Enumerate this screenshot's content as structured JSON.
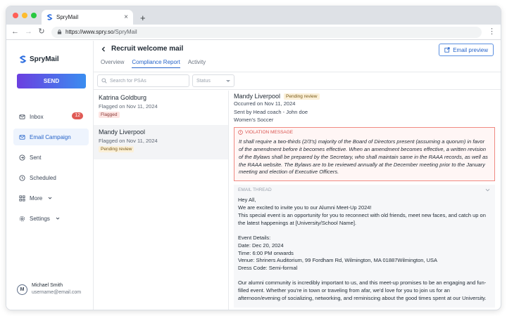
{
  "browser": {
    "tab_title": "SpryMail",
    "url_host": "https://www.spry.so",
    "url_path": "/SpryMail"
  },
  "sidebar": {
    "brand": "SpryMail",
    "send_label": "SEND",
    "items": [
      {
        "label": "Inbox",
        "icon": "inbox-icon",
        "badge": "12"
      },
      {
        "label": "Email Campaign",
        "icon": "mail-icon",
        "active": true
      },
      {
        "label": "Sent",
        "icon": "sent-icon"
      },
      {
        "label": "Scheduled",
        "icon": "clock-icon"
      },
      {
        "label": "More",
        "icon": "grid-icon"
      },
      {
        "label": "Settings",
        "icon": "gear-icon"
      }
    ],
    "user": {
      "initial": "M",
      "name": "Michael Smith",
      "email": "username@email.com"
    }
  },
  "header": {
    "title": "Recruit welcome mail",
    "preview_label": "Email preview",
    "tabs": [
      {
        "label": "Overview"
      },
      {
        "label": "Compliance Report",
        "active": true
      },
      {
        "label": "Activity"
      }
    ]
  },
  "filters": {
    "search_placeholder": "Search for PSAs",
    "status_placeholder": "Status"
  },
  "list": [
    {
      "name": "Katrina Goldburg",
      "date": "Flagged on Nov 11, 2024",
      "tag": "Flagged"
    },
    {
      "name": "Mandy Liverpool",
      "date": "Flagged on Nov 11, 2024",
      "tag": "Pending review"
    }
  ],
  "detail": {
    "name": "Mandy Liverpool",
    "status": "Pending review",
    "occurred": "Occurred on Nov 11, 2024",
    "sent_by": "Sent by Head coach - John doe",
    "team": "Women's Soccer",
    "violation_label": "VIOLATION MESSAGE",
    "violation_text": "It shall require a two-thirds (2/3's) majority of the Board of Directors present (assuming a quorum) in favor of the amendment before it becomes effective.  When an amendment becomes effective, a written revision of the Bylaws shall be prepared by the Secretary, who shall maintain same in the RAAA records, as well as the RAAA website.  The Bylaws are to be reviewed annually at the December meeting prior to the January meeting and election of Executive Officers.",
    "thread_label": "EMAIL THREAD",
    "thread": {
      "greeting": "Hey All,",
      "line1": "We are excited to invite you to our Alumni Meet-Up 2024!",
      "line2": "This special event is an opportunity for you to reconnect with old friends, meet new faces, and catch up on the latest happenings at [University/School Name].",
      "details_title": "Event Details:",
      "date": "Date: Dec 20, 2024",
      "time": "Time: 6:00 PM onwards",
      "venue": "Venue: Shriners Auditorium, 99 Fordham Rd, Wilmington, MA 01887Wilmington, USA",
      "dress": "Dress Code: Semi-formal",
      "closing": "Our alumni community is incredibly important to us, and this meet-up promises to be an engaging and fun-filled event. Whether you're in town or traveling from afar, we'd love for you to join us for an afternoon/evening of socializing, networking, and reminiscing about the good times spent at our University."
    }
  },
  "colors": {
    "accent": "#2563c9",
    "send_gradient_start": "#6b3fe0",
    "send_gradient_end": "#3a8df0",
    "violation": "#d9534f",
    "badge": "#e05a55"
  }
}
